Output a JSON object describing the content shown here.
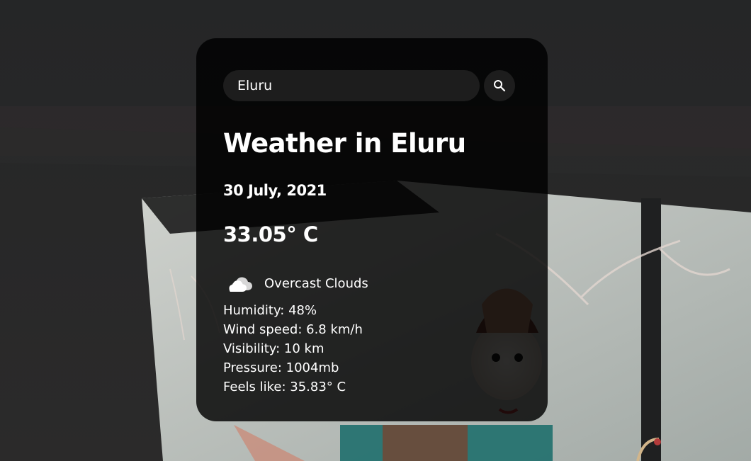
{
  "search": {
    "value": "Eluru",
    "placeholder": "Search"
  },
  "weather": {
    "title": "Weather in Eluru",
    "date": "30 July, 2021",
    "temperature": "33.05° C",
    "icon": "cloud-icon",
    "description": "Overcast Clouds",
    "details": [
      "Humidity: 48%",
      "Wind speed: 6.8 km/h",
      "Visibility: 10 km",
      "Pressure: 1004mb",
      "Feels like: 35.83° C"
    ]
  },
  "colors": {
    "card_background": "#000000",
    "text": "#ffffff",
    "input_background": "#1d1d1d"
  }
}
